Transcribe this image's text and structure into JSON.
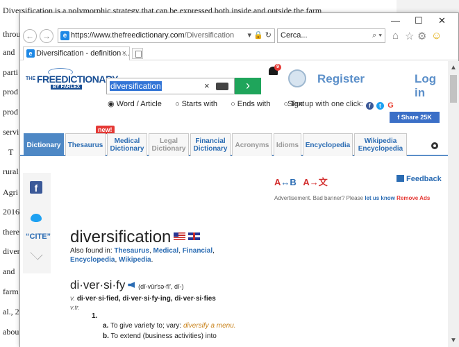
{
  "background_document": {
    "first_line": "Diversification is a polymorphic strategy that can be expressed both inside and outside the farm",
    "left_fragments": [
      "throu",
      "and",
      "parti",
      "prod",
      "prod",
      "servi",
      "T",
      "rural",
      "Agri",
      "2016",
      "there",
      "diver",
      "and",
      "farm",
      "al., 2",
      "abou"
    ]
  },
  "browser": {
    "url_prefix": "https://www.",
    "url_domain": "thefreedictionary.com",
    "url_path": "/Diversification",
    "search_placeholder": "Cerca...",
    "tab_title": "Diversification - definition ...",
    "window_controls": {
      "minimize": "—",
      "maximize": "☐",
      "close": "✕"
    }
  },
  "site": {
    "logo_the": "THE",
    "logo_main": "FREEDICTIONARY",
    "logo_sub": "BY FARLEX",
    "search_value": "diversification",
    "search_clear": "×",
    "search_go": "›",
    "search_modes": [
      "Word / Article",
      "Starts with",
      "Ends with",
      "Text"
    ],
    "notification_count": "9",
    "register_label": "Register",
    "login_label": "Log in",
    "signup_text": "Sign up with one click:",
    "share_label": "Share 25K",
    "new_badge": "new!",
    "tabs": [
      {
        "label": "Dictionary",
        "state": "active"
      },
      {
        "label": "Thesaurus",
        "state": "normal"
      },
      {
        "label": "Medical Dictionary",
        "state": "normal"
      },
      {
        "label": "Legal Dictionary",
        "state": "gray"
      },
      {
        "label": "Financial Dictionary",
        "state": "normal"
      },
      {
        "label": "Acronyms",
        "state": "gray"
      },
      {
        "label": "Idioms",
        "state": "gray"
      },
      {
        "label": "Encyclopedia",
        "state": "normal"
      },
      {
        "label": "Wikipedia Encyclopedia",
        "state": "normal"
      }
    ],
    "cite_label": "“CITE”",
    "font_tool_a": "A",
    "font_tool_arrow": "↔",
    "font_tool_b": "B",
    "translate_tool": "A→文",
    "feedback_label": "Feedback",
    "ad_note_prefix": "Advertisement. Bad banner? Please ",
    "ad_note_link": "let us know",
    "ad_note_remove": "Remove Ads"
  },
  "entry": {
    "headword": "diversification",
    "also_found_prefix": "Also found in: ",
    "also_found": [
      "Thesaurus",
      "Medical",
      "Financial",
      "Encyclopedia",
      "Wikipedia"
    ],
    "syllables": "di·ver·si·fy",
    "pronunciation": "(dĭ-vûr′sə-fī′, dī-)",
    "forms_pos": "v.",
    "forms_text": "di·ver·si·fied, di·ver·si·fy·ing, di·ver·si·fies",
    "vtr": "v.tr.",
    "sense_number": "1.",
    "def_a_label": "a.",
    "def_a_text": "To give variety to; vary:",
    "def_a_example": "diversify a menu.",
    "def_b_label": "b.",
    "def_b_text": "To extend (business activities) into"
  }
}
